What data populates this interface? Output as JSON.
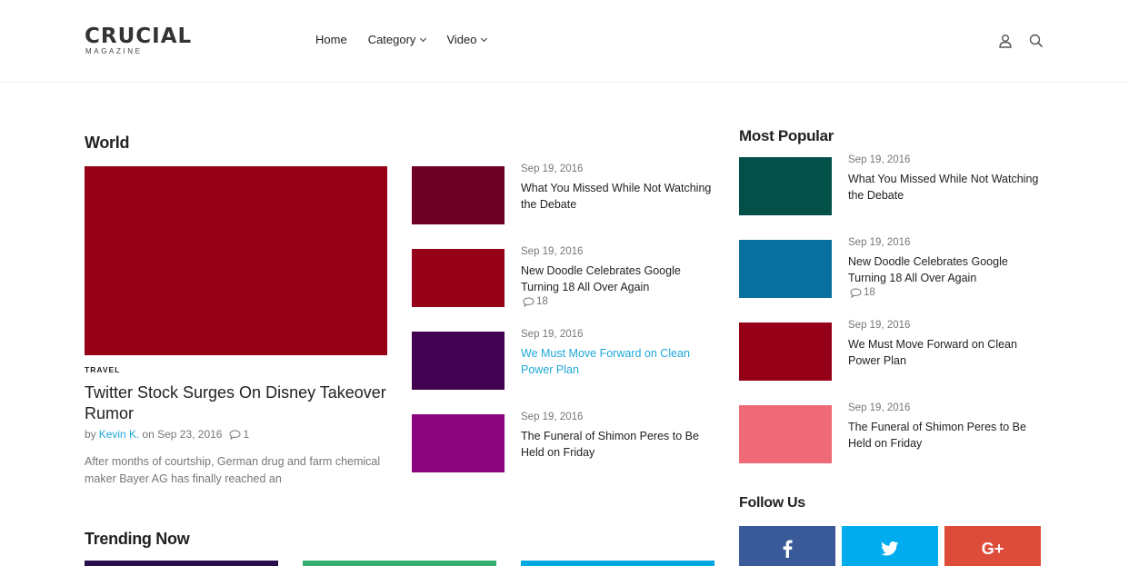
{
  "brand": {
    "name": "CRUCIAL",
    "tagline": "MAGAZINE"
  },
  "nav": [
    {
      "label": "Home",
      "dropdown": false
    },
    {
      "label": "Category",
      "dropdown": true
    },
    {
      "label": "Video",
      "dropdown": true
    }
  ],
  "header_icons": [
    "user-icon",
    "search-icon"
  ],
  "world": {
    "title": "World",
    "featured": {
      "category": "TRAVEL",
      "title": "Twitter Stock Surges On Disney Takeover Rumor",
      "by": "by",
      "author": "Kevin K.",
      "on": "on Sep 23, 2016",
      "comments": "1",
      "excerpt": "After months of courtship, German drug and farm chemical maker Bayer AG has finally reached an",
      "image_color": "#950018"
    },
    "items": [
      {
        "date": "Sep 19, 2016",
        "title": "What You Missed While Not Watching the Debate",
        "comments": "",
        "color": "#6d0024"
      },
      {
        "date": "Sep 19, 2016",
        "title": "New Doodle Celebrates Google Turning 18 All Over Again",
        "comments": "18",
        "color": "#950018"
      },
      {
        "date": "Sep 19, 2016",
        "title": "We Must Move Forward on Clean Power Plan",
        "comments": "",
        "color": "#430151"
      },
      {
        "date": "Sep 19, 2016",
        "title": "The Funeral of Shimon Peres to Be Held on Friday",
        "comments": "",
        "color": "#8b047c"
      }
    ]
  },
  "most_popular": {
    "title": "Most Popular",
    "items": [
      {
        "date": "Sep 19, 2016",
        "title": "What You Missed While Not Watching the Debate",
        "comments": "",
        "color": "#025048"
      },
      {
        "date": "Sep 19, 2016",
        "title": "New Doodle Celebrates Google Turning 18 All Over Again",
        "comments": "18",
        "color": "#0770a0"
      },
      {
        "date": "Sep 19, 2016",
        "title": "We Must Move Forward on Clean Power Plan",
        "comments": "",
        "color": "#950018"
      },
      {
        "date": "Sep 19, 2016",
        "title": "The Funeral of Shimon Peres to Be Held on Friday",
        "comments": "",
        "color": "#ed6a76"
      }
    ]
  },
  "follow_us": {
    "title": "Follow Us",
    "buttons": [
      {
        "network": "facebook",
        "glyph": "f",
        "color": "#3a5998"
      },
      {
        "network": "twitter",
        "glyph": "twitter-bird",
        "color": "#00acee"
      },
      {
        "network": "google-plus",
        "glyph": "G+",
        "color": "#dd4b39"
      }
    ]
  },
  "trending": {
    "title": "Trending Now",
    "bar_colors": [
      "#2a0f4f",
      "#36ae6f",
      "#00a7e1"
    ]
  },
  "colors": {
    "accent": "#1da8d8"
  }
}
